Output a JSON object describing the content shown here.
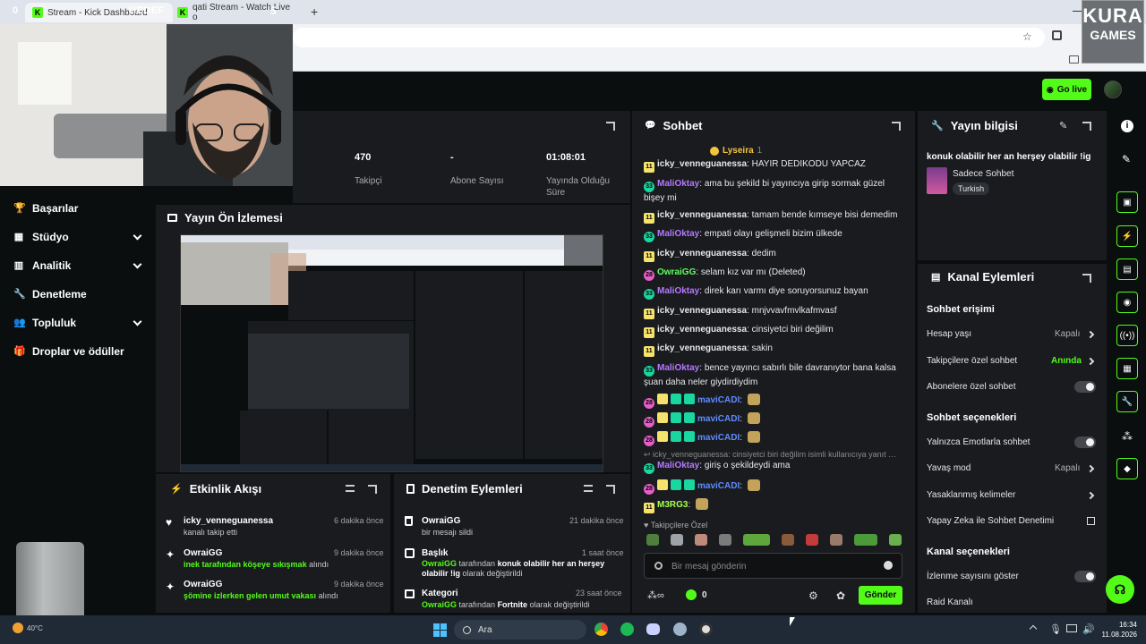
{
  "browser": {
    "tabs": [
      {
        "label": "Stream - Kick Dashboard"
      },
      {
        "label": "qati Stream - Watch Live o"
      }
    ],
    "tab_counter_left": "0",
    "tab_counter_right": "5",
    "overlay_hedef": "HEDEF",
    "new_tab": "+"
  },
  "overlay": {
    "logo_line1": "KURA",
    "logo_line2": "GAMES"
  },
  "header": {
    "go_live": "Go live"
  },
  "sidebar": {
    "items": [
      {
        "label": "Başarılar",
        "icon": "trophy-icon"
      },
      {
        "label": "Stüdyo",
        "icon": "studio-icon",
        "has_chevron": true
      },
      {
        "label": "Analitik",
        "icon": "chart-icon",
        "has_chevron": true
      },
      {
        "label": "Denetleme",
        "icon": "wrench-icon"
      },
      {
        "label": "Topluluk",
        "icon": "community-icon",
        "has_chevron": true
      },
      {
        "label": "Droplar ve ödüller",
        "icon": "gift-icon"
      }
    ]
  },
  "stats": [
    {
      "value": "470",
      "label": "Takipçi"
    },
    {
      "value": "-",
      "label": "Abone Sayısı"
    },
    {
      "value": "01:08:01",
      "label": "Yayında Olduğu Süre"
    }
  ],
  "preview": {
    "title": "Yayın Ön İzlemesi"
  },
  "chat": {
    "title": "Sohbet",
    "pinned_user": "Lyseira",
    "pinned_count": "1",
    "messages": [
      {
        "badges": [
          "11"
        ],
        "user": "icky_venneguanessa",
        "color": "white",
        "text": "HAYIR DEDIKODU YAPCAZ"
      },
      {
        "badges": [
          "33"
        ],
        "user": "MaliOktay",
        "color": "purple",
        "text": "ama bu şekild bi yayıncıya girip sormak güzel bişey mi"
      },
      {
        "badges": [
          "11"
        ],
        "user": "icky_venneguanessa",
        "color": "white",
        "text": "tamam bende kımseye bisi demedim"
      },
      {
        "badges": [
          "33"
        ],
        "user": "MaliOktay",
        "color": "purple",
        "text": "empati olayı gelişmeli bizim ülkede"
      },
      {
        "badges": [
          "11"
        ],
        "user": "icky_venneguanessa",
        "color": "white",
        "text": "dedim"
      },
      {
        "badges": [
          "28"
        ],
        "user": "OwraiGG",
        "color": "green",
        "text": "selam kız var mı (Deleted)"
      },
      {
        "badges": [
          "33"
        ],
        "user": "MaliOktay",
        "color": "purple",
        "text": "direk karı varmı diye soruyorsunuz bayan"
      },
      {
        "badges": [
          "11"
        ],
        "user": "icky_venneguanessa",
        "color": "white",
        "text": "mnjvvavfmvlkafmvasf"
      },
      {
        "badges": [
          "11"
        ],
        "user": "icky_venneguanessa",
        "color": "white",
        "text": "cinsiyetci biri değilim"
      },
      {
        "badges": [
          "11"
        ],
        "user": "icky_venneguanessa",
        "color": "white",
        "text": "sakin"
      },
      {
        "badges": [
          "33"
        ],
        "user": "MaliOktay",
        "color": "purple",
        "text": "bence yayıncı sabırlı bile davranıytor bana kalsa şuan daha neler giydirdiydim"
      },
      {
        "badges": [
          "28"
        ],
        "user": "maviCADI",
        "color": "blue",
        "text": ""
      },
      {
        "badges": [
          "28"
        ],
        "user": "maviCADI",
        "color": "blue",
        "text": ""
      },
      {
        "badges": [
          "28"
        ],
        "user": "maviCADI",
        "color": "blue",
        "text": ""
      },
      {
        "badges": [
          "33"
        ],
        "user": "MaliOktay",
        "color": "purple",
        "text": "giriş o şekildeydi ama"
      },
      {
        "badges": [
          "28"
        ],
        "user": "maviCADI",
        "color": "blue",
        "text": ""
      },
      {
        "badges": [
          "11"
        ],
        "user": "M3RG3",
        "color": "lime",
        "text": ""
      }
    ],
    "reply_hint": "icky_venneguanessa: cinsiyetci biri değilim isimli kullanıcıya yanıt veri...",
    "followers_only": "Takipçilere Özel",
    "input_placeholder": "Bir mesaj gönderin",
    "kick_count": "0",
    "send": "Gönder"
  },
  "stream_info": {
    "title": "Yayın bilgisi",
    "stream_title": "konuk olabilir her an herşey olabilir !ig",
    "category": "Sadece Sohbet",
    "language": "Turkish"
  },
  "channel_actions": {
    "title": "Kanal Eylemleri",
    "chat_access": "Sohbet erişimi",
    "account_age": {
      "label": "Hesap yaşı",
      "value": "Kapalı"
    },
    "followers_chat": {
      "label": "Takipçilere özel sohbet",
      "value": "Anında"
    },
    "subs_chat": {
      "label": "Abonelere özel sohbet"
    },
    "chat_options": "Sohbet seçenekleri",
    "emote_only": {
      "label": "Yalnızca Emotlarla sohbet"
    },
    "slow_mode": {
      "label": "Yavaş mod",
      "value": "Kapalı"
    },
    "banned_words": {
      "label": "Yasaklanmış kelimeler"
    },
    "ai_moderation": {
      "label": "Yapay Zeka ile Sohbet Denetimi"
    },
    "channel_options": "Kanal seçenekleri",
    "show_viewers": {
      "label": "İzlenme sayısını göster"
    },
    "raid": {
      "label": "Raid Kanalı"
    }
  },
  "activity": {
    "title": "Etkinlik Akışı",
    "items": [
      {
        "user": "icky_venneguanessa",
        "time": "6 dakika önce",
        "detail": "kanalı takip etti",
        "highlight": ""
      },
      {
        "user": "OwraiGG",
        "time": "9 dakika önce",
        "highlight": "inek tarafından köşeye sıkışmak",
        "detail": " alındı"
      },
      {
        "user": "OwraiGG",
        "time": "9 dakika önce",
        "highlight": "şömine izlerken gelen umut vakası",
        "detail": " alındı"
      }
    ]
  },
  "moderation": {
    "title": "Denetim Eylemleri",
    "items": [
      {
        "user": "OwraiGG",
        "time": "21 dakika önce",
        "detail": "bir mesajı sildi"
      },
      {
        "user": "Başlık",
        "time": "1 saat önce",
        "actor": "OwraiGG",
        "mid": " tarafından ",
        "value": "konuk olabilir her an herşey olabilir !ig",
        "tail": " olarak değiştirildi"
      },
      {
        "user": "Kategori",
        "time": "23 saat önce",
        "actor": "OwraiGG",
        "mid": " tarafından ",
        "value": "Fortnite",
        "tail": " olarak değiştirildi"
      }
    ]
  },
  "taskbar": {
    "search": "Ara",
    "time": "16:34",
    "date": "11.08.2026",
    "weather": "40°C"
  },
  "colors": {
    "accent": "#53fc18",
    "panel": "#191b1f",
    "background": "#0b0e0f"
  }
}
